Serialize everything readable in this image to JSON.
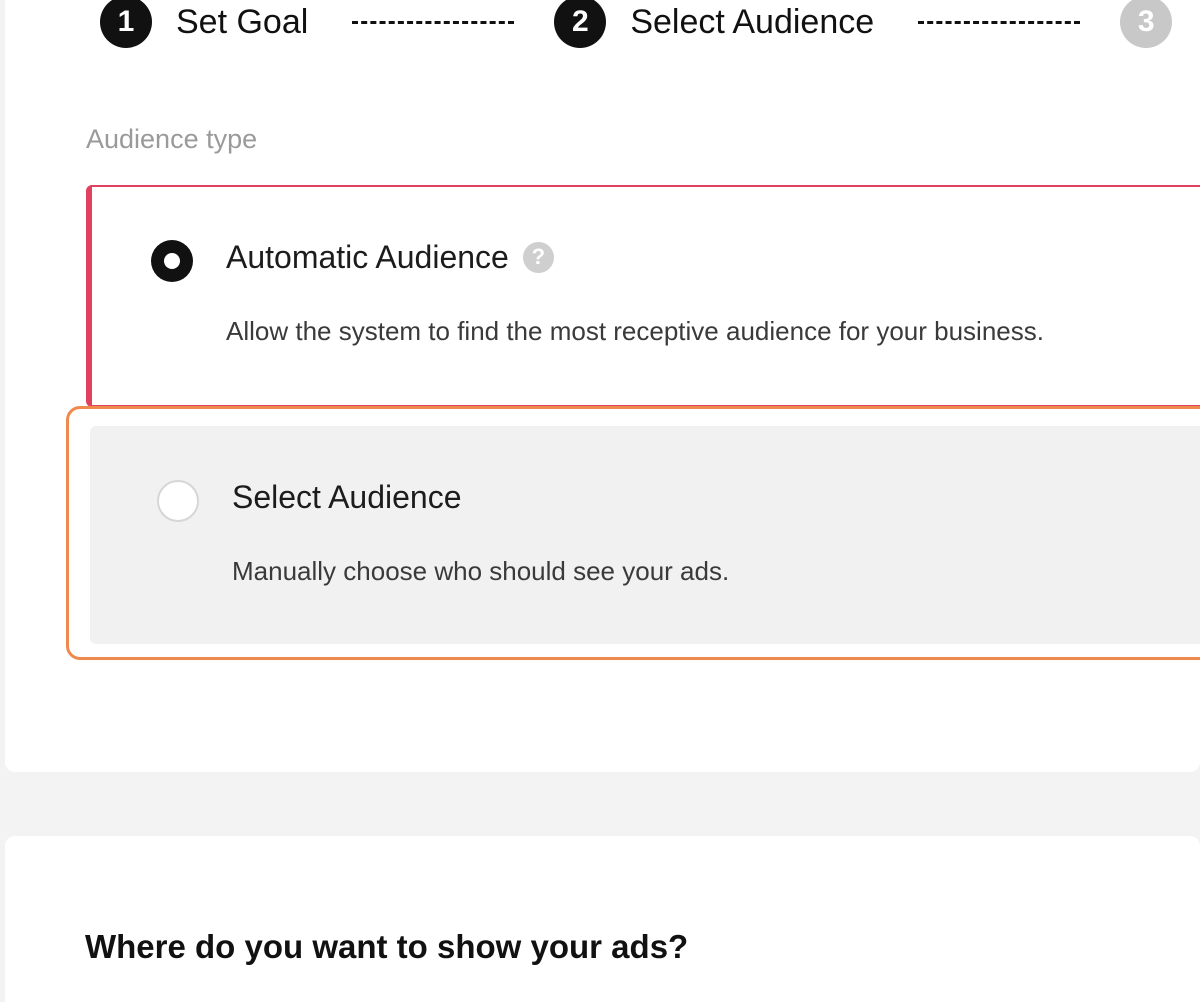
{
  "stepper": {
    "steps": [
      {
        "number": "1",
        "label": "Set Goal"
      },
      {
        "number": "2",
        "label": "Select Audience"
      },
      {
        "number": "3",
        "label": ""
      }
    ]
  },
  "audience": {
    "section_label": "Audience type",
    "options": [
      {
        "title": "Automatic Audience",
        "description": "Allow the system to find the most receptive audience for your business.",
        "selected": true
      },
      {
        "title": "Select Audience",
        "description": "Manually choose who should see your ads.",
        "selected": false
      }
    ]
  },
  "placement": {
    "title": "Where do you want to show your ads?"
  },
  "colors": {
    "selected_border": "#e0415e",
    "focus_ring": "#ef8a4e",
    "active_step": "#111111",
    "inactive_step": "#c8c8c8"
  },
  "icons": {
    "help": "question-mark-circle-icon"
  }
}
